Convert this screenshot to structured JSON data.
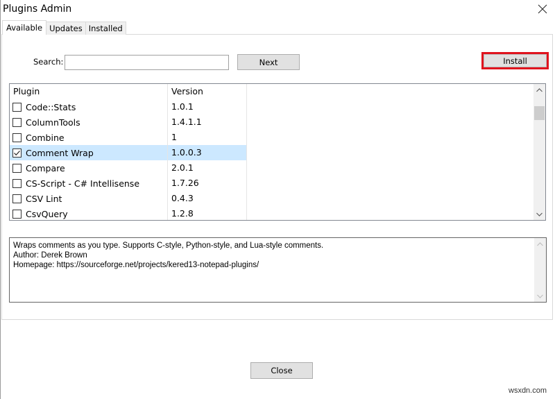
{
  "window": {
    "title": "Plugins Admin",
    "close_icon": "close-icon"
  },
  "tabs": [
    {
      "label": "Available",
      "active": true
    },
    {
      "label": "Updates",
      "active": false
    },
    {
      "label": "Installed",
      "active": false
    }
  ],
  "search": {
    "label": "Search:",
    "value": "",
    "placeholder": ""
  },
  "buttons": {
    "next": "Next",
    "install": "Install",
    "close": "Close"
  },
  "highlight": {
    "target": "install",
    "color": "#e0141e"
  },
  "plugin_list": {
    "columns": [
      "Plugin",
      "Version"
    ],
    "rows": [
      {
        "name": "Code::Stats",
        "version": "1.0.1",
        "checked": false,
        "selected": false
      },
      {
        "name": "ColumnTools",
        "version": "1.4.1.1",
        "checked": false,
        "selected": false
      },
      {
        "name": "Combine",
        "version": "1",
        "checked": false,
        "selected": false
      },
      {
        "name": "Comment Wrap",
        "version": "1.0.0.3",
        "checked": true,
        "selected": true
      },
      {
        "name": "Compare",
        "version": "2.0.1",
        "checked": false,
        "selected": false
      },
      {
        "name": "CS-Script - C# Intellisense",
        "version": "1.7.26",
        "checked": false,
        "selected": false
      },
      {
        "name": "CSV Lint",
        "version": "0.4.3",
        "checked": false,
        "selected": false
      },
      {
        "name": "CsvQuery",
        "version": "1.2.8",
        "checked": false,
        "selected": false
      }
    ],
    "selection_color": "#cce8ff"
  },
  "description": {
    "lines": [
      "Wraps comments as you type. Supports C-style, Python-style, and Lua-style comments.",
      "Author: Derek Brown",
      "Homepage: https://sourceforge.net/projects/kered13-notepad-plugins/"
    ]
  },
  "watermark": "wsxdn.com"
}
